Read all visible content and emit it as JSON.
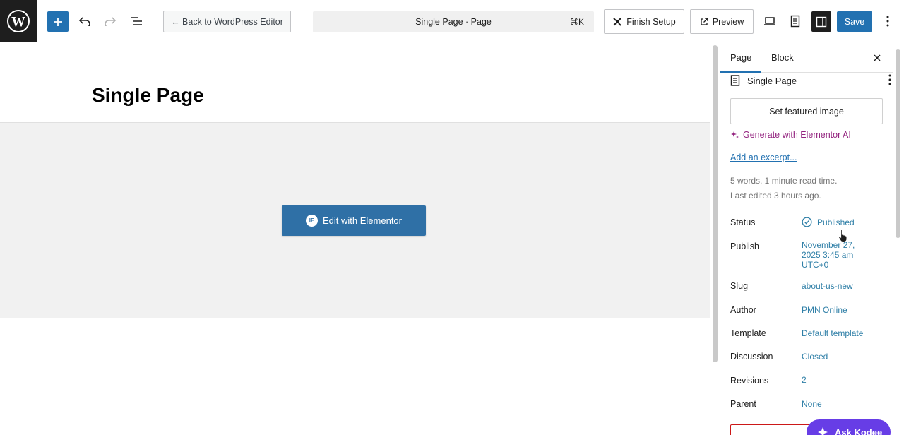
{
  "topbar": {
    "back_label": "← Back to WordPress Editor",
    "doc_title": "Single Page · Page",
    "shortcut": "⌘K",
    "finish_setup_label": "Finish Setup",
    "preview_label": "Preview",
    "save_label": "Save"
  },
  "canvas": {
    "title": "Single Page",
    "elementor_button_label": "Edit with Elementor",
    "elementor_badge": "IE"
  },
  "sidebar": {
    "tabs": [
      {
        "label": "Page"
      },
      {
        "label": "Block"
      }
    ],
    "doc_name": "Single Page",
    "featured_image_label": "Set featured image",
    "ai_label": "Generate with Elementor AI",
    "excerpt_label": "Add an excerpt...",
    "word_count": "5 words, 1 minute read time.",
    "last_edited": "Last edited 3 hours ago.",
    "rows": [
      {
        "label": "Status",
        "value": "Published"
      },
      {
        "label": "Publish",
        "value": "November 27, 2025 3:45 am UTC+0"
      },
      {
        "label": "Slug",
        "value": "about-us-new"
      },
      {
        "label": "Author",
        "value": "PMN Online"
      },
      {
        "label": "Template",
        "value": "Default template"
      },
      {
        "label": "Discussion",
        "value": "Closed"
      },
      {
        "label": "Revisions",
        "value": "2"
      },
      {
        "label": "Parent",
        "value": "None"
      }
    ]
  },
  "assistant": {
    "label": "Ask Kodee"
  },
  "colors": {
    "accent": "#2271b1",
    "elementor": "#2f70a6",
    "ai_purple": "#93237f",
    "kodee": "#673de6",
    "link_teal": "#2f7fa7"
  },
  "icons": [
    "wordpress-logo",
    "plus-icon",
    "undo-icon",
    "redo-icon",
    "list-view-icon",
    "finish-setup-icon",
    "external-link-icon",
    "desktop-icon",
    "document-icon",
    "sidebar-icon",
    "kebab-icon",
    "close-icon",
    "page-icon",
    "sparkle-icon",
    "check-circle-icon",
    "kodee-icon"
  ]
}
